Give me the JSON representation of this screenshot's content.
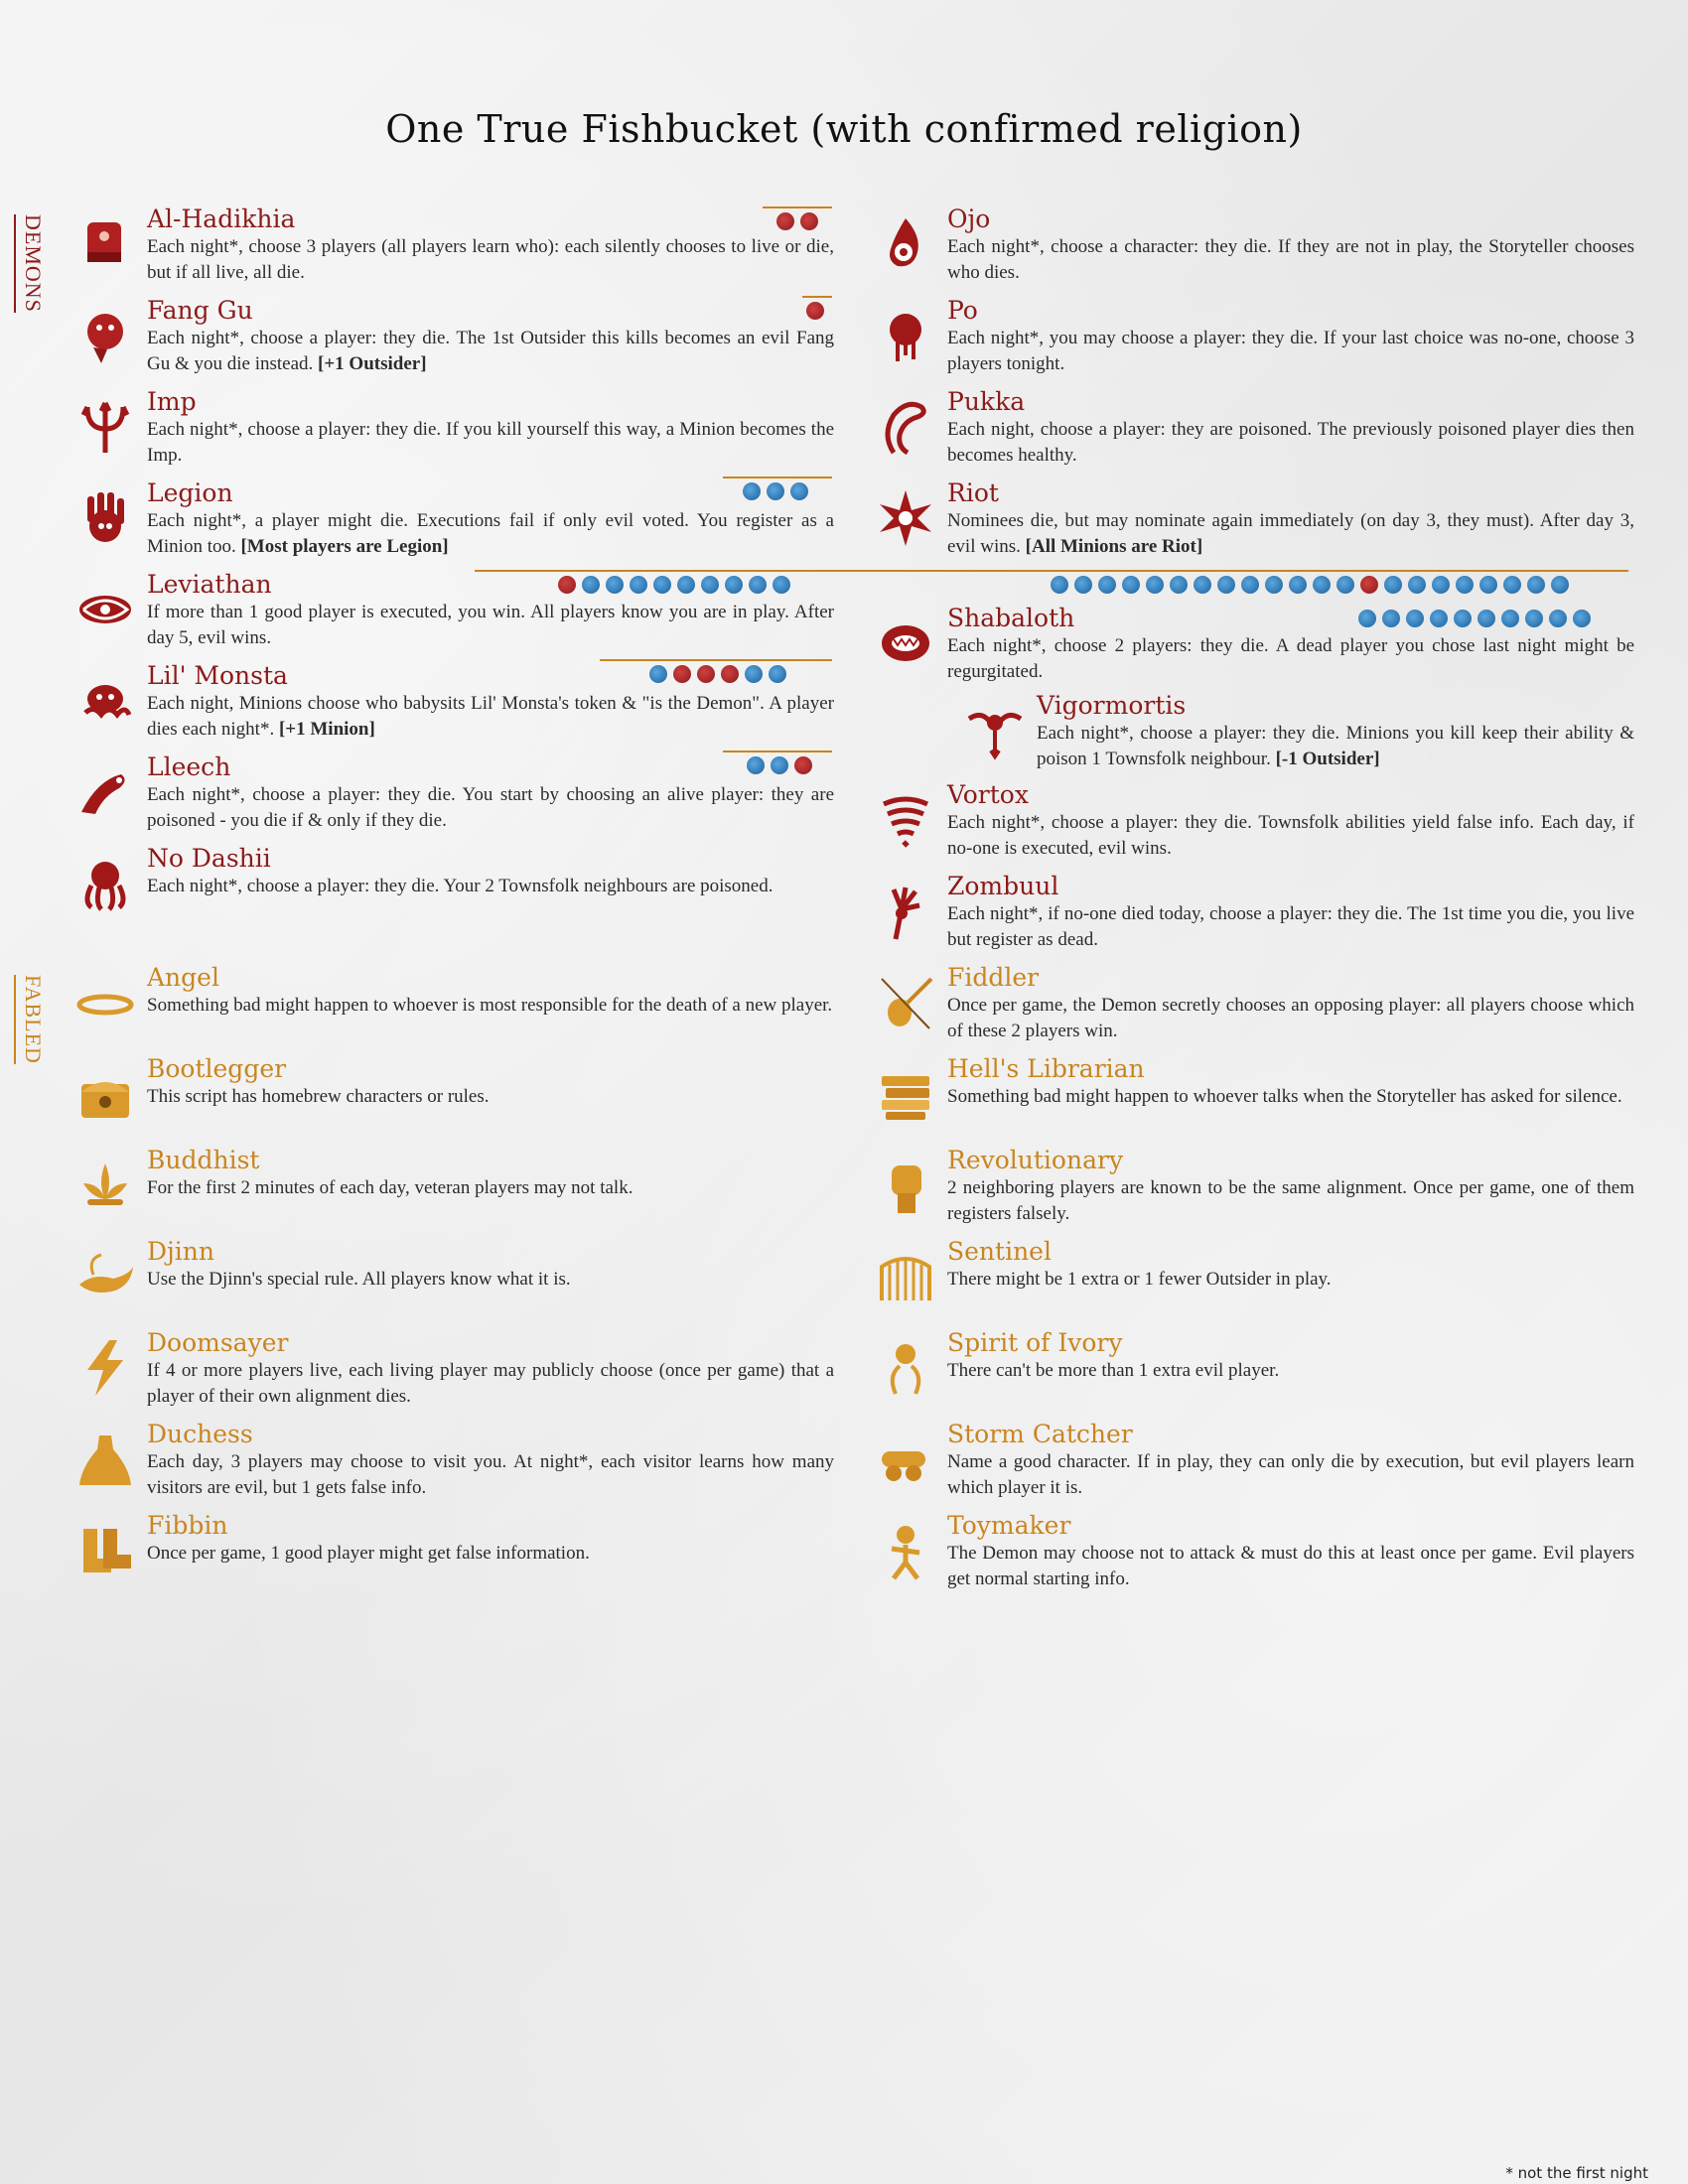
{
  "title": "One True Fishbucket (with confirmed religion)",
  "sections": {
    "demons": "DEMONS",
    "fabled": "FABLED"
  },
  "footnote": "* not the first night",
  "demons_left": [
    {
      "name": "Al-Hadikhia",
      "ability": "Each night*, choose 3 players (all players learn who): each silently chooses to live or die, but if all live, all die.",
      "extra": ""
    },
    {
      "name": "Fang Gu",
      "ability": "Each night*, choose a player: they die. The 1st Outsider this kills becomes an evil Fang Gu & you die instead.",
      "extra": "[+1 Outsider]"
    },
    {
      "name": "Imp",
      "ability": "Each night*, choose a player: they die. If you kill yourself this way, a Minion becomes the Imp.",
      "extra": ""
    },
    {
      "name": "Legion",
      "ability": "Each night*, a player might die. Executions fail if only evil voted. You register as a Minion too.",
      "extra": "[Most players are Legion]"
    },
    {
      "name": "Leviathan",
      "ability": "If more than 1 good player is executed, you win. All players know you are in play. After day 5, evil wins.",
      "extra": ""
    },
    {
      "name": "Lil' Monsta",
      "ability": "Each night, Minions choose who babysits Lil' Monsta's token & \"is the Demon\". A player dies each night*.",
      "extra": "[+1 Minion]"
    },
    {
      "name": "Lleech",
      "ability": "Each night*, choose a player: they die. You start by choosing an alive player: they are poisoned - you die if & only if they die.",
      "extra": ""
    },
    {
      "name": "No Dashii",
      "ability": "Each night*, choose a player: they die. Your 2 Townsfolk neighbours are poisoned.",
      "extra": ""
    }
  ],
  "demons_right": [
    {
      "name": "Ojo",
      "ability": "Each night*, choose a character: they die. If they are not in play, the Storyteller chooses who dies.",
      "extra": ""
    },
    {
      "name": "Po",
      "ability": "Each night*, you may choose a player: they die. If your last choice was no-one, choose 3 players tonight.",
      "extra": ""
    },
    {
      "name": "Pukka",
      "ability": "Each night, choose a player: they are poisoned. The previously poisoned player dies then becomes healthy.",
      "extra": ""
    },
    {
      "name": "Riot",
      "ability": "Nominees die, but may nominate again immediately (on day 3, they must). After day 3, evil wins.",
      "extra": "[All Minions are Riot]"
    },
    {
      "name": "Shabaloth",
      "ability": "Each night*, choose 2 players: they die. A dead player you chose last night might be regurgitated.",
      "extra": ""
    },
    {
      "name": "Vigormortis",
      "ability": "Each night*, choose a player: they die. Minions you kill keep their ability & poison 1 Townsfolk neighbour.",
      "extra": "[-1 Outsider]"
    },
    {
      "name": "Vortox",
      "ability": "Each night*, choose a player: they die. Townsfolk abilities yield false info. Each day, if no-one is executed, evil wins.",
      "extra": ""
    },
    {
      "name": "Zombuul",
      "ability": "Each night*, if no-one died today, choose a player: they die. The 1st time you die, you live but register as dead.",
      "extra": ""
    }
  ],
  "fabled_left": [
    {
      "name": "Angel",
      "ability": "Something bad might happen to whoever is most responsible for the death of a new player."
    },
    {
      "name": "Bootlegger",
      "ability": "This script has homebrew characters or rules."
    },
    {
      "name": "Buddhist",
      "ability": "For the first 2 minutes of each day, veteran players may not talk."
    },
    {
      "name": "Djinn",
      "ability": "Use the Djinn's special rule. All players know what it is."
    },
    {
      "name": "Doomsayer",
      "ability": "If 4 or more players live, each living player may publicly choose (once per game) that a player of their own alignment dies."
    },
    {
      "name": "Duchess",
      "ability": "Each day, 3 players may choose to visit you. At night*, each visitor learns how many visitors are evil, but 1 gets false info."
    },
    {
      "name": "Fibbin",
      "ability": "Once per game, 1 good player might get false information."
    }
  ],
  "fabled_right": [
    {
      "name": "Fiddler",
      "ability": "Once per game, the Demon secretly chooses an opposing player: all players choose which of these 2 players win."
    },
    {
      "name": "Hell's Librarian",
      "ability": "Something bad might happen to whoever talks when the Storyteller has asked for silence."
    },
    {
      "name": "Revolutionary",
      "ability": "2 neighboring players are known to be the same alignment. Once per game, one of them registers falsely."
    },
    {
      "name": "Sentinel",
      "ability": "There might be 1 extra or 1 fewer Outsider in play."
    },
    {
      "name": "Spirit of Ivory",
      "ability": "There can't be more than 1 extra evil player."
    },
    {
      "name": "Storm Catcher",
      "ability": "Name a good character. If in play, they can only die by execution, but evil players learn which player it is."
    },
    {
      "name": "Toymaker",
      "ability": "The Demon may choose not to attack & must do this at least once per game. Evil players get normal starting info."
    }
  ],
  "colors": {
    "demon": "#8c1a1a",
    "fabled": "#c9851f"
  }
}
